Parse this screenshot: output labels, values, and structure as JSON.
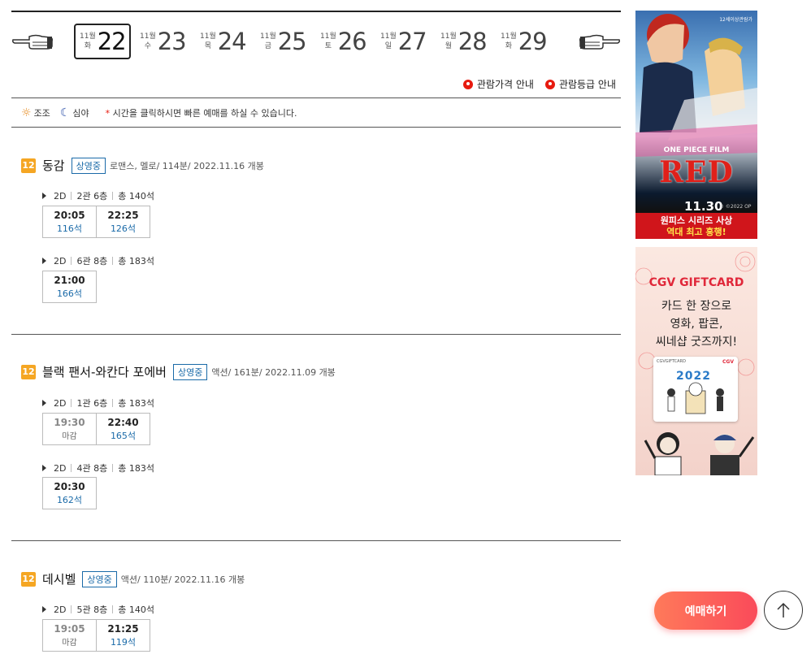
{
  "dates": [
    {
      "month": "11월",
      "day": "22",
      "weekday": "화",
      "selected": true
    },
    {
      "month": "11월",
      "day": "23",
      "weekday": "수",
      "selected": false
    },
    {
      "month": "11월",
      "day": "24",
      "weekday": "목",
      "selected": false
    },
    {
      "month": "11월",
      "day": "25",
      "weekday": "금",
      "selected": false
    },
    {
      "month": "11월",
      "day": "26",
      "weekday": "토",
      "selected": false
    },
    {
      "month": "11월",
      "day": "27",
      "weekday": "일",
      "selected": false
    },
    {
      "month": "11월",
      "day": "28",
      "weekday": "월",
      "selected": false
    },
    {
      "month": "11월",
      "day": "29",
      "weekday": "화",
      "selected": false
    }
  ],
  "info_links": {
    "price": "관람가격 안내",
    "rating": "관람등급 안내"
  },
  "legend": {
    "morning": "조조",
    "night": "심야",
    "note_star": "*",
    "note": "시간을 클릭하시면 빠른 예매를 하실 수 있습니다."
  },
  "movies": [
    {
      "age": "12",
      "title": "동감",
      "status": "상영중",
      "meta": "로맨스, 멜로/ 114분/ 2022.11.16 개봉",
      "halls": [
        {
          "format": "2D",
          "hall": "2관 6층",
          "seats": "총 140석",
          "times": [
            {
              "time": "20:05",
              "sub": "116석",
              "closed": false
            },
            {
              "time": "22:25",
              "sub": "126석",
              "closed": false
            }
          ]
        },
        {
          "format": "2D",
          "hall": "6관 8층",
          "seats": "총 183석",
          "times": [
            {
              "time": "21:00",
              "sub": "166석",
              "closed": false
            }
          ]
        }
      ]
    },
    {
      "age": "12",
      "title": "블랙 팬서-와칸다 포에버",
      "status": "상영중",
      "meta": "액션/ 161분/ 2022.11.09 개봉",
      "halls": [
        {
          "format": "2D",
          "hall": "1관 6층",
          "seats": "총 183석",
          "times": [
            {
              "time": "19:30",
              "sub": "마감",
              "closed": true
            },
            {
              "time": "22:40",
              "sub": "165석",
              "closed": false
            }
          ]
        },
        {
          "format": "2D",
          "hall": "4관 8층",
          "seats": "총 183석",
          "times": [
            {
              "time": "20:30",
              "sub": "162석",
              "closed": false
            }
          ]
        }
      ]
    },
    {
      "age": "12",
      "title": "데시벨",
      "status": "상영중",
      "meta": "액션/ 110분/ 2022.11.16 개봉",
      "halls": [
        {
          "format": "2D",
          "hall": "5관 8층",
          "seats": "총 140석",
          "times": [
            {
              "time": "19:05",
              "sub": "마감",
              "closed": true
            },
            {
              "time": "21:25",
              "sub": "119석",
              "closed": false
            }
          ]
        }
      ]
    }
  ],
  "ads": {
    "onepiece": {
      "tagline": "12세이상관람가",
      "film_label": "ONE PIECE FILM",
      "title": "RED",
      "date": "11.30",
      "copyright": "© ©2022 OP",
      "banner_line1": "원피스 시리즈 사상",
      "banner_line2": "역대 최고 흥행!"
    },
    "giftcard": {
      "title": "CGV GIFTCARD",
      "line1": "카드 한 장으로",
      "line2": "영화, 팝콘,",
      "line3": "씨네샵 굿즈까지!",
      "card_brand": "CGVGIFTCARD",
      "card_logo": "CGV",
      "card_year": "2022"
    }
  },
  "buttons": {
    "reserve": "예매하기",
    "top_icon": "arrow-up-icon"
  },
  "colors": {
    "accent_red": "#e71a0f",
    "seat_blue": "#1a6aa8",
    "age_badge": "#f5a623",
    "reserve_gradient_start": "#ff7a5a",
    "reserve_gradient_end": "#fa4a5a"
  }
}
